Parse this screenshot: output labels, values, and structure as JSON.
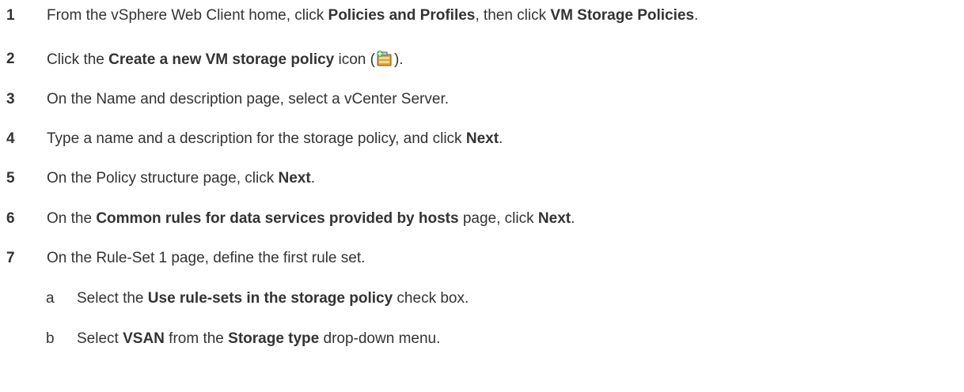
{
  "steps": [
    {
      "num": "1",
      "parts": [
        {
          "t": "From the vSphere Web Client home, click "
        },
        {
          "t": "Policies and Profiles",
          "b": true
        },
        {
          "t": ", then click "
        },
        {
          "t": "VM Storage Policies",
          "b": true
        },
        {
          "t": "."
        }
      ]
    },
    {
      "num": "2",
      "parts": [
        {
          "t": "Click the "
        },
        {
          "t": "Create a new VM storage policy",
          "b": true
        },
        {
          "t": " icon ("
        },
        {
          "icon": "create-storage-policy-icon"
        },
        {
          "t": ")."
        }
      ]
    },
    {
      "num": "3",
      "parts": [
        {
          "t": "On the Name and description page, select a vCenter Server."
        }
      ]
    },
    {
      "num": "4",
      "parts": [
        {
          "t": "Type a name and a description for the storage policy, and click "
        },
        {
          "t": "Next",
          "b": true
        },
        {
          "t": "."
        }
      ]
    },
    {
      "num": "5",
      "parts": [
        {
          "t": "On the Policy structure page, click "
        },
        {
          "t": "Next",
          "b": true
        },
        {
          "t": "."
        }
      ]
    },
    {
      "num": "6",
      "parts": [
        {
          "t": "On the "
        },
        {
          "t": "Common rules for data services provided by hosts",
          "b": true
        },
        {
          "t": " page, click "
        },
        {
          "t": "Next",
          "b": true
        },
        {
          "t": "."
        }
      ]
    },
    {
      "num": "7",
      "parts": [
        {
          "t": "On the Rule-Set 1 page, define the first rule set."
        }
      ]
    }
  ],
  "substeps": [
    {
      "num": "a",
      "parts": [
        {
          "t": "Select the "
        },
        {
          "t": "Use rule-sets in the storage policy",
          "b": true
        },
        {
          "t": " check box."
        }
      ]
    },
    {
      "num": "b",
      "parts": [
        {
          "t": "Select "
        },
        {
          "t": "VSAN",
          "b": true
        },
        {
          "t": " from the "
        },
        {
          "t": "Storage type",
          "b": true
        },
        {
          "t": " drop-down menu."
        }
      ]
    }
  ]
}
